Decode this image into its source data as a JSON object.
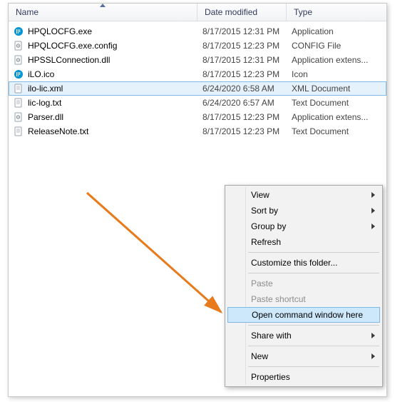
{
  "header": {
    "name": "Name",
    "date": "Date modified",
    "type": "Type"
  },
  "files": [
    {
      "icon": "hp",
      "name": "HPQLOCFG.exe",
      "date": "8/17/2015 12:31 PM",
      "type": "Application"
    },
    {
      "icon": "gear",
      "name": "HPQLOCFG.exe.config",
      "date": "8/17/2015 12:23 PM",
      "type": "CONFIG File"
    },
    {
      "icon": "gear",
      "name": "HPSSLConnection.dll",
      "date": "8/17/2015 12:31 PM",
      "type": "Application extens..."
    },
    {
      "icon": "hp",
      "name": "iLO.ico",
      "date": "8/17/2015 12:23 PM",
      "type": "Icon"
    },
    {
      "icon": "file",
      "name": "ilo-lic.xml",
      "date": "6/24/2020 6:58 AM",
      "type": "XML Document",
      "selected": true
    },
    {
      "icon": "file",
      "name": "lic-log.txt",
      "date": "6/24/2020 6:57 AM",
      "type": "Text Document"
    },
    {
      "icon": "gear",
      "name": "Parser.dll",
      "date": "8/17/2015 12:23 PM",
      "type": "Application extens..."
    },
    {
      "icon": "file",
      "name": "ReleaseNote.txt",
      "date": "8/17/2015 12:23 PM",
      "type": "Text Document"
    }
  ],
  "menu": [
    {
      "label": "View",
      "sub": true
    },
    {
      "label": "Sort by",
      "sub": true
    },
    {
      "label": "Group by",
      "sub": true
    },
    {
      "label": "Refresh"
    },
    {
      "sep": true
    },
    {
      "label": "Customize this folder..."
    },
    {
      "sep": true
    },
    {
      "label": "Paste",
      "disabled": true
    },
    {
      "label": "Paste shortcut",
      "disabled": true
    },
    {
      "label": "Open command window here",
      "highlight": true
    },
    {
      "sep": true
    },
    {
      "label": "Share with",
      "sub": true
    },
    {
      "sep": true
    },
    {
      "label": "New",
      "sub": true
    },
    {
      "sep": true
    },
    {
      "label": "Properties"
    }
  ],
  "colors": {
    "accent": "#E77A1B"
  }
}
